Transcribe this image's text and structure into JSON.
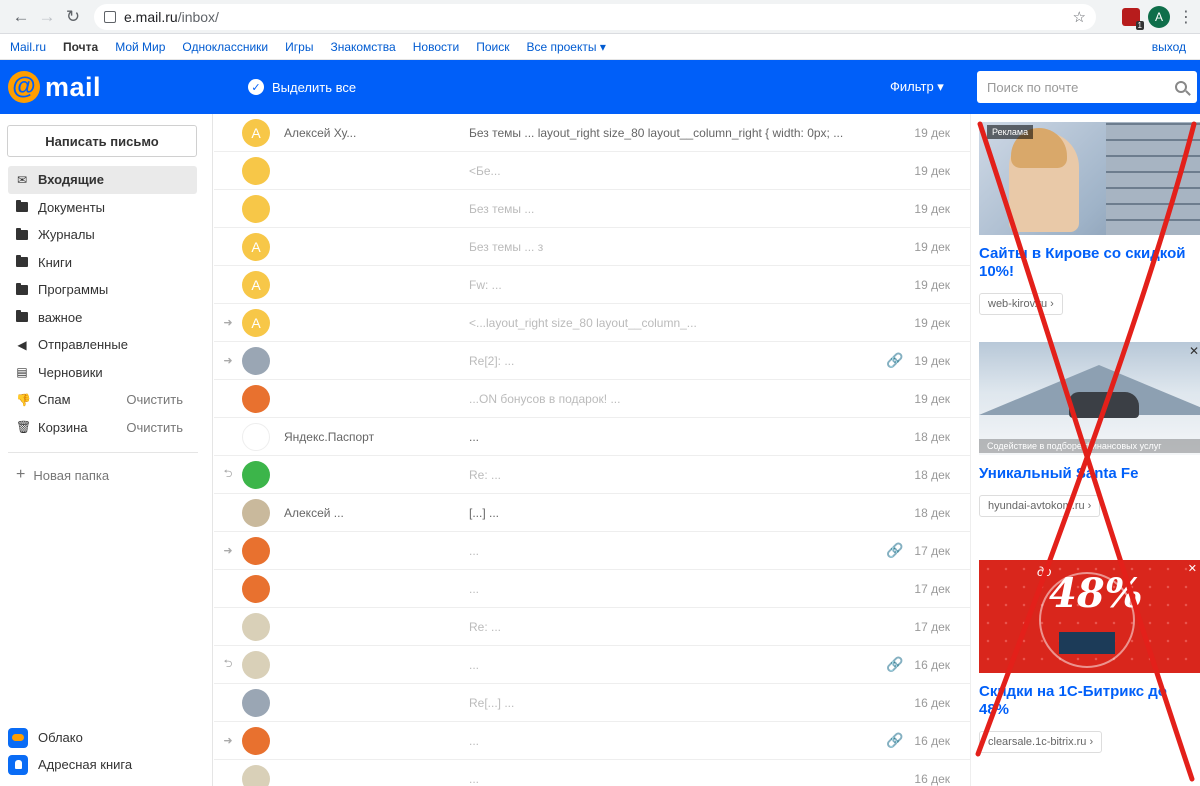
{
  "browser": {
    "url_host": "e.mail.ru",
    "url_path": "/inbox/",
    "profile_initial": "A",
    "ext_badge": "1"
  },
  "portal_nav": {
    "items": [
      "Mail.ru",
      "Почта",
      "Мой Мир",
      "Одноклассники",
      "Игры",
      "Знакомства",
      "Новости",
      "Поиск",
      "Все проекты ▾"
    ],
    "active": "Почта",
    "logout": "выход"
  },
  "mail_header": {
    "logo_text": "mail",
    "select_all": "Выделить все",
    "filter": "Фильтр ▾",
    "search_placeholder": "Поиск по почте"
  },
  "sidebar": {
    "compose": "Написать письмо",
    "folders": [
      {
        "label": "Входящие",
        "icon": "inbox-icon",
        "active": true,
        "action": ""
      },
      {
        "label": "Документы",
        "icon": "folder-icon",
        "active": false,
        "action": ""
      },
      {
        "label": "Журналы",
        "icon": "folder-icon",
        "active": false,
        "action": ""
      },
      {
        "label": "Книги",
        "icon": "folder-icon",
        "active": false,
        "action": ""
      },
      {
        "label": "Программы",
        "icon": "folder-icon",
        "active": false,
        "action": ""
      },
      {
        "label": "важное",
        "icon": "folder-icon",
        "active": false,
        "action": ""
      },
      {
        "label": "Отправленные",
        "icon": "sent-icon",
        "active": false,
        "action": ""
      },
      {
        "label": "Черновики",
        "icon": "drafts-icon",
        "active": false,
        "action": ""
      },
      {
        "label": "Спам",
        "icon": "spam-icon",
        "active": false,
        "action": "Очистить"
      },
      {
        "label": "Корзина",
        "icon": "trash-icon",
        "active": false,
        "action": "Очистить"
      }
    ],
    "new_folder": "Новая папка",
    "apps": [
      {
        "label": "Облако",
        "icon": "cloud-icon"
      },
      {
        "label": "Адресная книга",
        "icon": "contacts-icon"
      }
    ]
  },
  "messages": [
    {
      "arrow": "",
      "avatar": "A",
      "avatar_color": "#f7c748",
      "sender": "Алексей Ху...",
      "subject": "Без темы ... layout_right size_80 layout__column_right { width: 0px; ...",
      "attach": false,
      "date": "19 дек"
    },
    {
      "arrow": "",
      "avatar": "",
      "avatar_color": "#f7c748",
      "sender": "",
      "subject": "<Бе...",
      "attach": false,
      "date": "19 дек"
    },
    {
      "arrow": "",
      "avatar": "",
      "avatar_color": "#f7c748",
      "sender": "",
      "subject": "Без темы ...",
      "attach": false,
      "date": "19 дек"
    },
    {
      "arrow": "",
      "avatar": "A",
      "avatar_color": "#f7c748",
      "sender": "",
      "subject": "Без темы ... з",
      "attach": false,
      "date": "19 дек"
    },
    {
      "arrow": "",
      "avatar": "A",
      "avatar_color": "#f7c748",
      "sender": "",
      "subject": "Fw: ...",
      "attach": false,
      "date": "19 дек"
    },
    {
      "arrow": "➜",
      "avatar": "A",
      "avatar_color": "#f7c748",
      "sender": "",
      "subject": "<...layout_right size_80 layout__column_...",
      "attach": false,
      "date": "19 дек"
    },
    {
      "arrow": "➜",
      "avatar": "",
      "avatar_color": "#9aa6b4",
      "sender": "",
      "subject": "Re[2]: ...",
      "attach": true,
      "date": "19 дек"
    },
    {
      "arrow": "",
      "avatar": "",
      "avatar_color": "#e8712f",
      "sender": "",
      "subject": "...ON бонусов в подарок! ...",
      "attach": false,
      "date": "19 дек"
    },
    {
      "arrow": "",
      "avatar": "",
      "avatar_color": "#ffffff",
      "sender": "Яндекс.Паспорт",
      "subject": "...",
      "attach": false,
      "date": "18 дек"
    },
    {
      "arrow": "⮌",
      "avatar": "",
      "avatar_color": "#3cb54a",
      "sender": "",
      "subject": "Re: ...",
      "attach": false,
      "date": "18 дек"
    },
    {
      "arrow": "",
      "avatar": "",
      "avatar_color": "#c9b99c",
      "sender": "Алексей ...",
      "subject": "[...] ...",
      "attach": false,
      "date": "18 дек"
    },
    {
      "arrow": "➜",
      "avatar": "",
      "avatar_color": "#e8712f",
      "sender": "",
      "subject": "...",
      "attach": true,
      "date": "17 дек"
    },
    {
      "arrow": "",
      "avatar": "",
      "avatar_color": "#e8712f",
      "sender": "",
      "subject": "...",
      "attach": false,
      "date": "17 дек"
    },
    {
      "arrow": "",
      "avatar": "",
      "avatar_color": "#d9d0b8",
      "sender": "",
      "subject": "Re: ...",
      "attach": false,
      "date": "17 дек"
    },
    {
      "arrow": "⮌",
      "avatar": "",
      "avatar_color": "#d9d0b8",
      "sender": "",
      "subject": "...",
      "attach": true,
      "date": "16 дек"
    },
    {
      "arrow": "",
      "avatar": "",
      "avatar_color": "#9aa6b4",
      "sender": "",
      "subject": "Re[...] ...",
      "attach": false,
      "date": "16 дек"
    },
    {
      "arrow": "➜",
      "avatar": "",
      "avatar_color": "#e8712f",
      "sender": "",
      "subject": "...",
      "attach": true,
      "date": "16 дек"
    },
    {
      "arrow": "",
      "avatar": "",
      "avatar_color": "#d9d0b8",
      "sender": "",
      "subject": "...",
      "attach": false,
      "date": "16 дек"
    }
  ],
  "ads": {
    "label": "Реклама",
    "items": [
      {
        "title": "Сайты в Кирове со скидкой 10%!",
        "domain": "web-kirov.ru ›",
        "caption": ""
      },
      {
        "title": "Уникальный Santa Fe",
        "domain": "hyundai-avtokom.ru ›",
        "caption": "Содействие в подборе финансовых услуг"
      },
      {
        "title": "Скидки на 1С-Битрикс до 48%",
        "domain": "clearsale.1c-bitrix.ru ›",
        "caption": "",
        "promo_prefix": "до",
        "promo": "48%"
      }
    ]
  },
  "colors": {
    "brand_blue": "#005ff9",
    "logo_orange": "#ff9e00",
    "scribble_red": "#e3201a"
  }
}
